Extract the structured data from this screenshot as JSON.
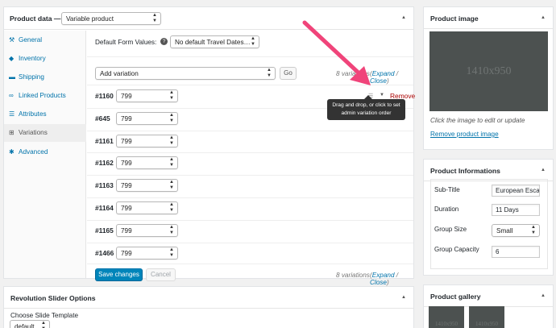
{
  "product_data": {
    "title": "Product data —",
    "type_select": "Variable product",
    "tabs": [
      {
        "label": "General",
        "icon": "wrench-icon"
      },
      {
        "label": "Inventory",
        "icon": "tag-icon"
      },
      {
        "label": "Shipping",
        "icon": "truck-icon"
      },
      {
        "label": "Linked Products",
        "icon": "link-icon"
      },
      {
        "label": "Attributes",
        "icon": "list-icon"
      },
      {
        "label": "Variations",
        "icon": "grid-icon",
        "active": true
      },
      {
        "label": "Advanced",
        "icon": "gear-icon"
      }
    ],
    "default_form_label": "Default Form Values:",
    "default_form_help": "?",
    "default_form_select": "No default Travel Dates…",
    "add_variation_select": "Add variation",
    "go_button": "Go",
    "variations_count_top": "8 variations",
    "expand": "Expand",
    "slash": "/",
    "close": "Close",
    "variations": [
      {
        "id": "#1160",
        "value": "799"
      },
      {
        "id": "#645",
        "value": "799"
      },
      {
        "id": "#1161",
        "value": "799"
      },
      {
        "id": "#1162",
        "value": "799"
      },
      {
        "id": "#1163",
        "value": "799"
      },
      {
        "id": "#1164",
        "value": "799"
      },
      {
        "id": "#1165",
        "value": "799"
      },
      {
        "id": "#1466",
        "value": "799"
      }
    ],
    "remove": "Remove",
    "tooltip_line1": "Drag and drop, or click to set",
    "tooltip_line2": "admin variation order",
    "save_changes": "Save changes",
    "cancel": "Cancel",
    "variations_count_bottom": "8 variations"
  },
  "product_image": {
    "title": "Product image",
    "placeholder": "1410x950",
    "hint": "Click the image to edit or update",
    "remove_link": "Remove product image"
  },
  "product_info": {
    "title": "Product Informations",
    "subtitle_label": "Sub-Title",
    "subtitle_value": "European Esca",
    "duration_label": "Duration",
    "duration_value": "11 Days",
    "group_size_label": "Group Size",
    "group_size_value": "Small",
    "group_capacity_label": "Group Capacity",
    "group_capacity_value": "6"
  },
  "revolution": {
    "title": "Revolution Slider Options",
    "choose_label": "Choose Slide Template",
    "template_select": "default"
  },
  "gallery": {
    "title": "Product gallery",
    "thumb1": "1410x950",
    "thumb2": "1410x950"
  },
  "colors": {
    "accent": "#0073aa",
    "primary_button": "#0085ba",
    "remove": "#aa0000",
    "arrow": "#f0447a",
    "image_placeholder": "#4c5150"
  }
}
